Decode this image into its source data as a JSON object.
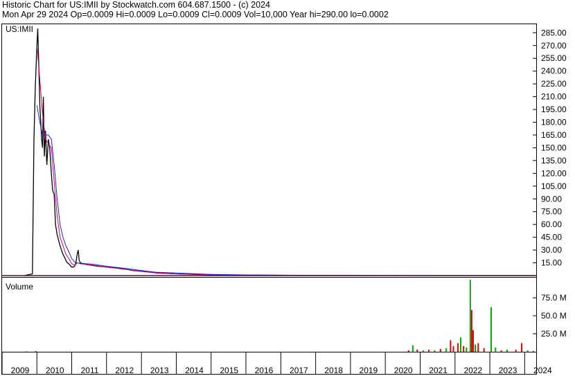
{
  "header": {
    "line1": "Historic Chart for US:IMII by Stockwatch.com 604.687.1500 - (c) 2024",
    "line2": "Mon Apr 29 2024   Op=0.0009   Hi=0.0009   Lo=0.0009   Cl=0.0009   Vol=10,000   Year hi=290.00   lo=0.0002"
  },
  "chart_data": [
    {
      "type": "line",
      "label": "US:IMII",
      "ylim": [
        0,
        295
      ],
      "yticks": [
        "285.00",
        "270.00",
        "255.00",
        "240.00",
        "225.00",
        "210.00",
        "195.00",
        "180.00",
        "165.00",
        "150.00",
        "135.00",
        "120.00",
        "105.00",
        "90.00",
        "75.00",
        "60.00",
        "45.00",
        "30.00",
        "15.00"
      ],
      "x_start": "2009-01-01",
      "x_end": "2024-05-01",
      "series": [
        {
          "color": "#000000",
          "x": [
            "2009-09-01",
            "2009-10-01",
            "2009-11-15",
            "2009-12-01",
            "2009-12-15",
            "2010-01-01",
            "2010-01-10",
            "2010-01-20",
            "2010-02-01",
            "2010-02-10",
            "2010-02-20",
            "2010-03-01",
            "2010-03-10",
            "2010-03-20",
            "2010-04-01",
            "2010-04-15",
            "2010-05-01",
            "2010-05-15",
            "2010-06-01",
            "2010-06-15",
            "2010-07-01",
            "2010-07-15",
            "2010-08-01",
            "2010-08-15",
            "2010-09-01",
            "2010-09-15",
            "2010-10-01",
            "2010-10-15",
            "2010-11-01",
            "2010-11-15",
            "2010-12-01",
            "2010-12-15",
            "2011-01-01",
            "2011-01-15",
            "2011-02-01",
            "2011-02-15",
            "2011-03-01",
            "2011-03-10",
            "2011-03-20",
            "2011-04-01",
            "2011-05-01",
            "2011-06-01",
            "2011-08-01",
            "2011-10-01",
            "2012-01-01",
            "2012-04-01",
            "2012-07-01",
            "2012-10-01",
            "2013-01-01",
            "2013-04-01",
            "2013-07-01",
            "2014-01-01",
            "2014-07-01",
            "2015-01-01",
            "2016-01-01",
            "2017-01-01",
            "2018-01-01",
            "2019-01-01",
            "2020-01-01",
            "2021-01-01",
            "2022-01-01",
            "2023-01-01",
            "2024-04-29"
          ],
          "values": [
            0.3,
            1,
            2,
            160,
            220,
            270,
            290,
            250,
            200,
            180,
            160,
            150,
            210,
            140,
            170,
            130,
            160,
            150,
            120,
            100,
            95,
            60,
            48,
            42,
            35,
            30,
            25,
            22,
            18,
            15,
            14,
            12,
            10,
            10,
            11,
            16,
            26,
            30,
            18,
            15,
            14,
            13,
            12,
            11,
            10,
            9,
            8,
            6,
            5,
            4,
            3,
            2,
            1.5,
            1,
            0.5,
            0.3,
            0.2,
            0.1,
            0.05,
            0.02,
            0.01,
            0.005,
            0.0009
          ]
        },
        {
          "color": "#cc0077",
          "x": [
            "2010-01-01",
            "2010-02-01",
            "2010-03-01",
            "2010-04-01",
            "2010-05-01",
            "2010-06-01",
            "2010-07-01",
            "2010-08-01",
            "2010-09-01",
            "2010-10-01",
            "2010-11-01",
            "2010-12-01",
            "2011-01-01",
            "2011-02-01",
            "2011-03-01",
            "2011-04-01",
            "2011-06-01",
            "2011-09-01",
            "2012-01-01",
            "2012-06-01",
            "2013-01-01",
            "2013-06-01",
            "2014-01-01",
            "2015-01-01",
            "2016-01-01",
            "2018-01-01",
            "2020-01-01",
            "2022-01-01",
            "2024-04-29"
          ],
          "values": [
            270,
            230,
            190,
            160,
            155,
            150,
            110,
            70,
            45,
            35,
            25,
            20,
            14,
            12,
            15,
            14,
            13,
            12,
            10,
            8,
            5,
            3,
            2,
            1,
            0.5,
            0.2,
            0.05,
            0.01,
            0.001
          ]
        },
        {
          "color": "#2222cc",
          "x": [
            "2010-01-01",
            "2010-02-01",
            "2010-03-01",
            "2010-04-01",
            "2010-05-01",
            "2010-06-01",
            "2010-07-01",
            "2010-08-01",
            "2010-09-01",
            "2010-10-01",
            "2010-11-01",
            "2010-12-01",
            "2011-01-01",
            "2011-02-01",
            "2011-04-01",
            "2011-06-01",
            "2011-09-01",
            "2012-01-01",
            "2012-06-01",
            "2013-01-01",
            "2013-06-01",
            "2014-01-01",
            "2015-01-01",
            "2016-01-01",
            "2018-01-01",
            "2020-01-01",
            "2022-01-01",
            "2024-04-29"
          ],
          "values": [
            200,
            180,
            165,
            165,
            165,
            160,
            130,
            90,
            60,
            45,
            35,
            28,
            20,
            16,
            14,
            14,
            13,
            11,
            9,
            6,
            4,
            3,
            1.5,
            0.8,
            0.3,
            0.1,
            0.02,
            0.001
          ]
        }
      ]
    },
    {
      "type": "bar",
      "label": "Volume",
      "ylim": [
        0,
        100
      ],
      "yticks": [
        "75.0 M",
        "50.0 M",
        "25.0 M"
      ],
      "x_start": "2009-01-01",
      "x_end": "2024-05-01",
      "bars": [
        {
          "x": "2009-09-15",
          "v": 0.5,
          "c": "#dd0000"
        },
        {
          "x": "2009-12-20",
          "v": 1,
          "c": "#dd0000"
        },
        {
          "x": "2020-09-01",
          "v": 2,
          "c": "#dd0000"
        },
        {
          "x": "2020-10-15",
          "v": 9,
          "c": "#00aa00"
        },
        {
          "x": "2020-12-01",
          "v": 3,
          "c": "#dd0000"
        },
        {
          "x": "2021-02-01",
          "v": 2,
          "c": "#00aa00"
        },
        {
          "x": "2021-04-01",
          "v": 3,
          "c": "#dd0000"
        },
        {
          "x": "2021-06-01",
          "v": 2,
          "c": "#00aa00"
        },
        {
          "x": "2021-08-01",
          "v": 4,
          "c": "#dd0000"
        },
        {
          "x": "2021-10-01",
          "v": 5,
          "c": "#00aa00"
        },
        {
          "x": "2021-11-15",
          "v": 16,
          "c": "#dd0000"
        },
        {
          "x": "2021-12-15",
          "v": 8,
          "c": "#dd0000"
        },
        {
          "x": "2022-02-01",
          "v": 12,
          "c": "#dd0000"
        },
        {
          "x": "2022-03-01",
          "v": 20,
          "c": "#00aa00"
        },
        {
          "x": "2022-04-01",
          "v": 8,
          "c": "#dd0000"
        },
        {
          "x": "2022-05-01",
          "v": 6,
          "c": "#00aa00"
        },
        {
          "x": "2022-06-10",
          "v": 100,
          "c": "#00aa00"
        },
        {
          "x": "2022-06-25",
          "v": 58,
          "c": "#dd0000"
        },
        {
          "x": "2022-07-10",
          "v": 30,
          "c": "#dd0000"
        },
        {
          "x": "2022-08-01",
          "v": 10,
          "c": "#00aa00"
        },
        {
          "x": "2022-09-01",
          "v": 12,
          "c": "#dd0000"
        },
        {
          "x": "2022-11-01",
          "v": 5,
          "c": "#dd0000"
        },
        {
          "x": "2023-01-15",
          "v": 62,
          "c": "#00aa00"
        },
        {
          "x": "2023-03-01",
          "v": 6,
          "c": "#00aa00"
        },
        {
          "x": "2023-05-01",
          "v": 2,
          "c": "#dd0000"
        },
        {
          "x": "2023-07-01",
          "v": 3,
          "c": "#00aa00"
        },
        {
          "x": "2023-10-01",
          "v": 3,
          "c": "#dd0000"
        },
        {
          "x": "2023-12-01",
          "v": 12,
          "c": "#dd0000"
        },
        {
          "x": "2024-02-01",
          "v": 2,
          "c": "#00aa00"
        },
        {
          "x": "2024-04-01",
          "v": 1,
          "c": "#dd0000"
        }
      ]
    }
  ],
  "x_axis": {
    "labels": [
      "2009",
      "2010",
      "2011",
      "2012",
      "2013",
      "2014",
      "2015",
      "2016",
      "2017",
      "2018",
      "2019",
      "2020",
      "2021",
      "2022",
      "2023",
      "2024"
    ]
  }
}
